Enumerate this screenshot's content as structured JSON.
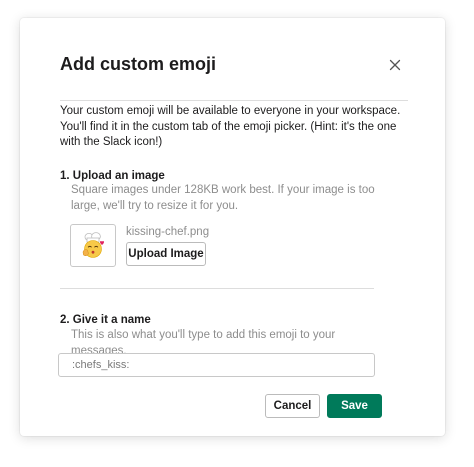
{
  "dialog": {
    "title": "Add custom emoji",
    "close_icon": "close-icon",
    "intro_text": "Your custom emoji will be available to everyone in your workspace. You'll find it in the custom tab of the emoji picker. (Hint: it's the one with the Slack icon!)"
  },
  "upload_section": {
    "heading": "1. Upload an image",
    "help_text": "Square images under 128KB work best. If your image is too large, we'll try to resize it for you.",
    "preview_icon": "chef-kiss-emoji",
    "filename": "kissing-chef.png",
    "upload_button_label": "Upload Image"
  },
  "name_section": {
    "heading": "2. Give it a name",
    "help_text": "This is also what you'll type to add this emoji to your messages.",
    "input_value": ":chefs_kiss:"
  },
  "footer": {
    "cancel_label": "Cancel",
    "save_label": "Save"
  },
  "colors": {
    "primary": "#007a5a",
    "muted_text": "#8d8d8d",
    "text": "#1d1c1d"
  }
}
